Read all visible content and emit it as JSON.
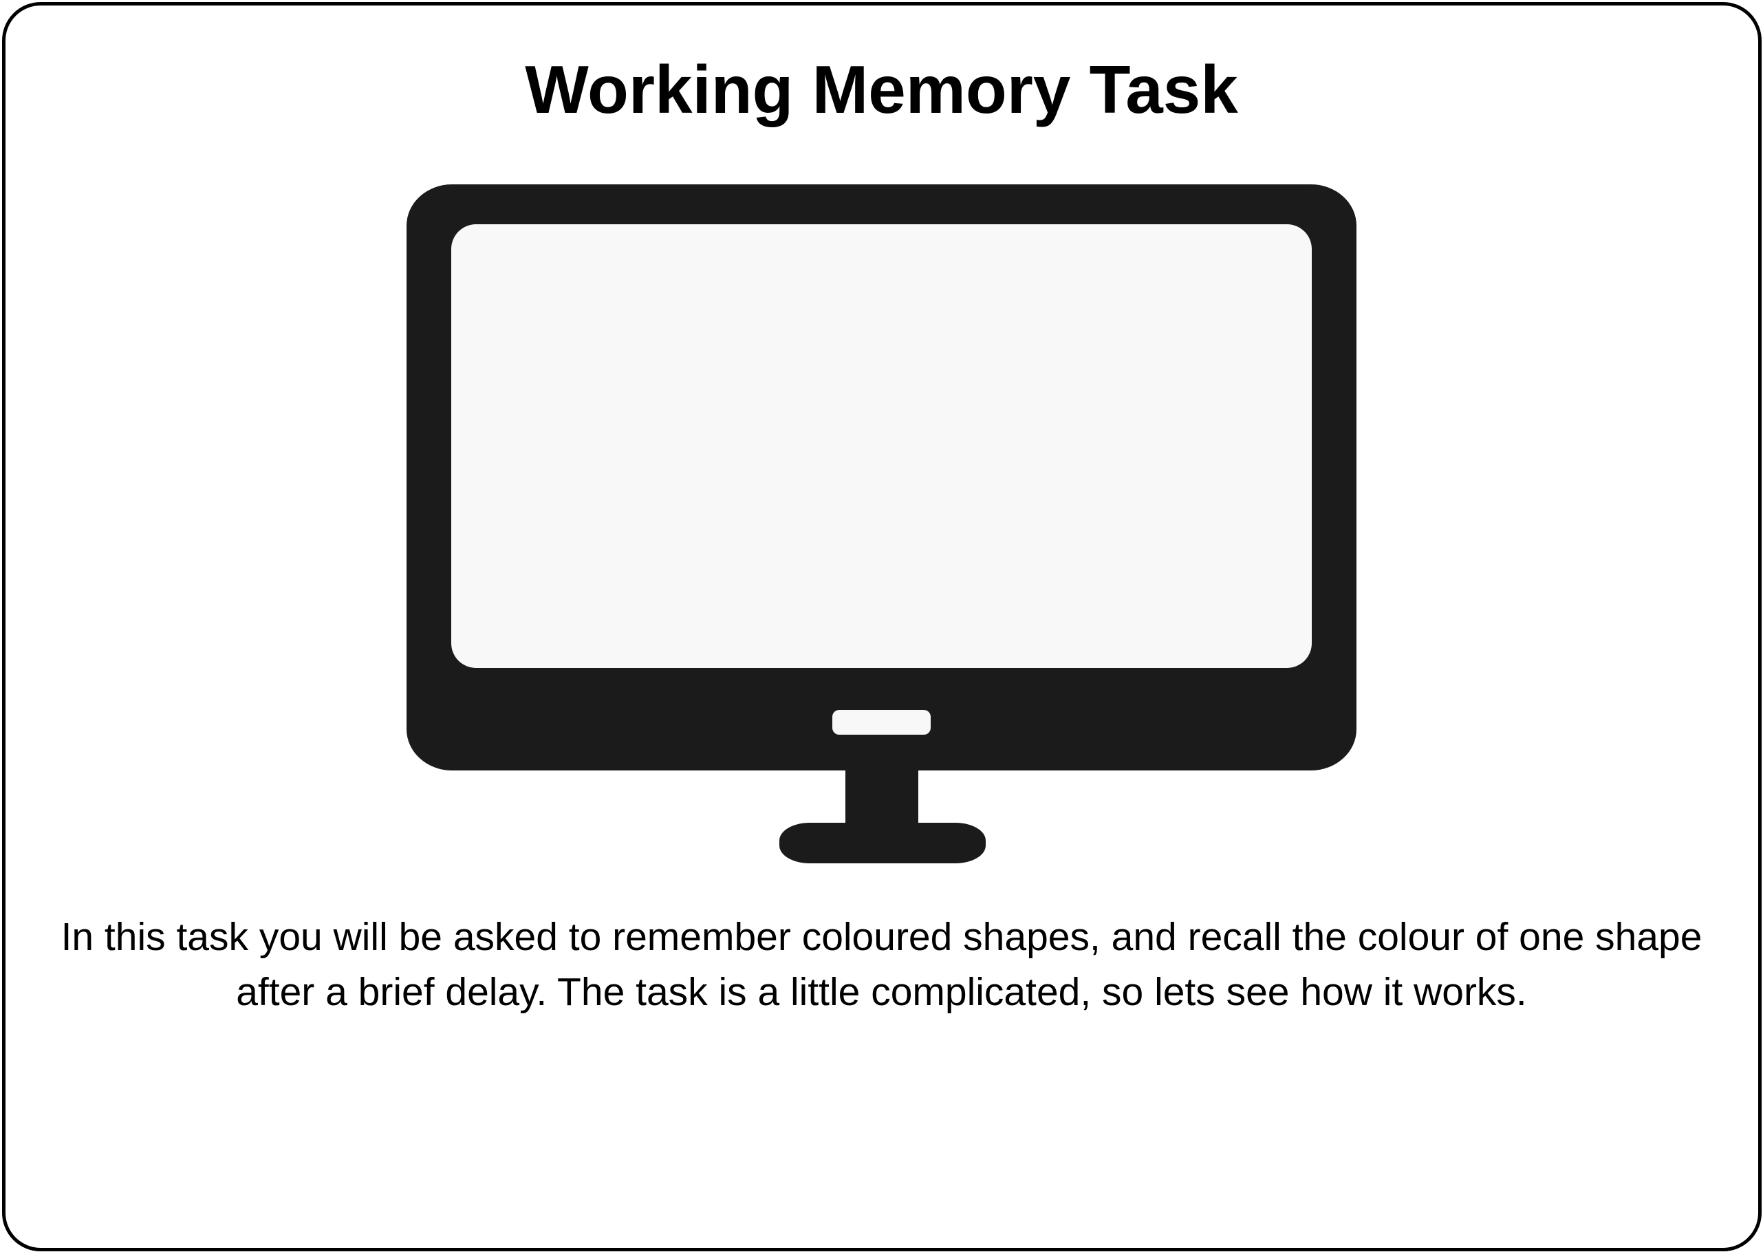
{
  "page": {
    "title": "Working Memory Task",
    "instructions": "In this task you will be asked to remember coloured shapes, and recall the colour of one shape after a brief delay. The task is a little complicated, so lets see how it works."
  },
  "illustration": {
    "icon": "monitor-icon"
  },
  "colors": {
    "monitor_body": "#1b1b1b",
    "screen": "#f8f8f8",
    "border": "#000000",
    "text": "#000000"
  }
}
